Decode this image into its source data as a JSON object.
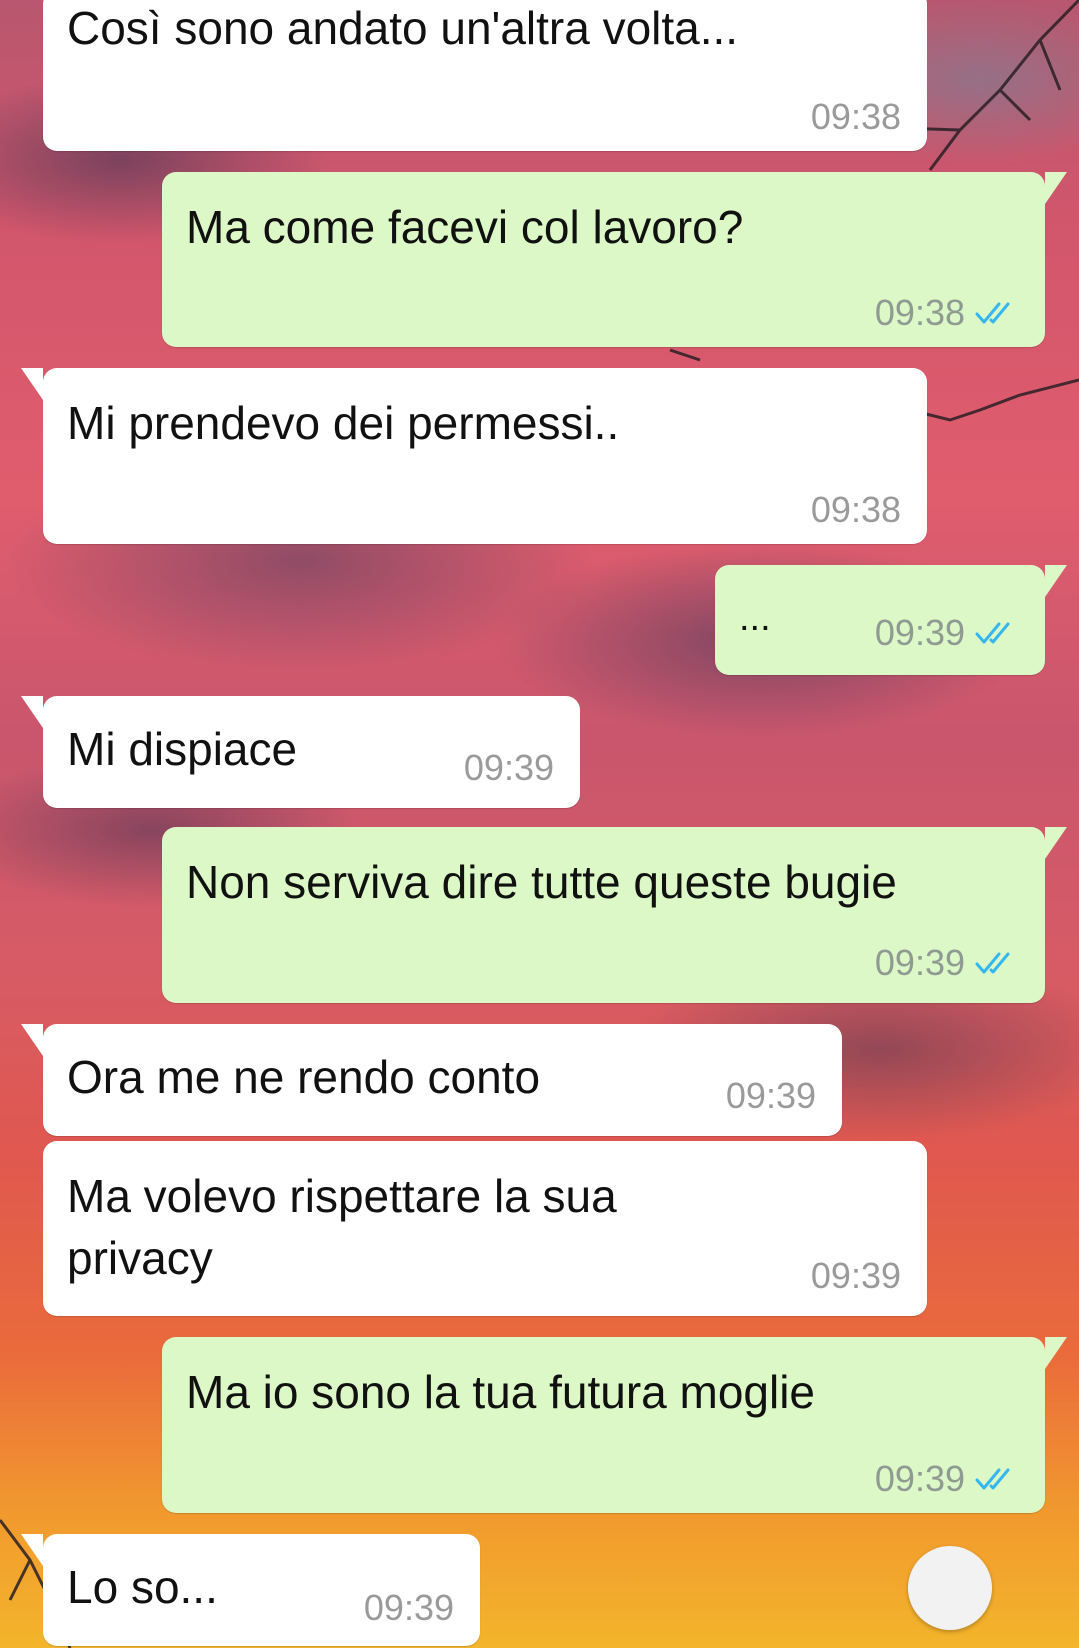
{
  "chat": {
    "messages": [
      {
        "text": "Così sono andato un'altra volta...",
        "time": "09:38"
      },
      {
        "text": "Ma come facevi col lavoro?",
        "time": "09:38"
      },
      {
        "text": "Mi prendevo dei permessi..",
        "time": "09:38"
      },
      {
        "text": "...",
        "time": "09:39"
      },
      {
        "text": "Mi dispiace",
        "time": "09:39"
      },
      {
        "text": "Non serviva dire tutte queste bugie",
        "time": "09:39"
      },
      {
        "text": "Ora me ne rendo conto",
        "time": "09:39"
      },
      {
        "text": "Ma volevo rispettare la sua privacy",
        "time": "09:39"
      },
      {
        "text": "Ma io sono la tua futura moglie",
        "time": "09:39"
      },
      {
        "text": "Lo so...",
        "time": "09:39"
      }
    ]
  },
  "colors": {
    "incoming_bubble": "#ffffff",
    "outgoing_bubble": "#dcf8c6",
    "read_ticks": "#34b7f1"
  },
  "icons": {
    "read_receipt": "double-check-icon",
    "scroll_button": "scroll-down-button"
  }
}
